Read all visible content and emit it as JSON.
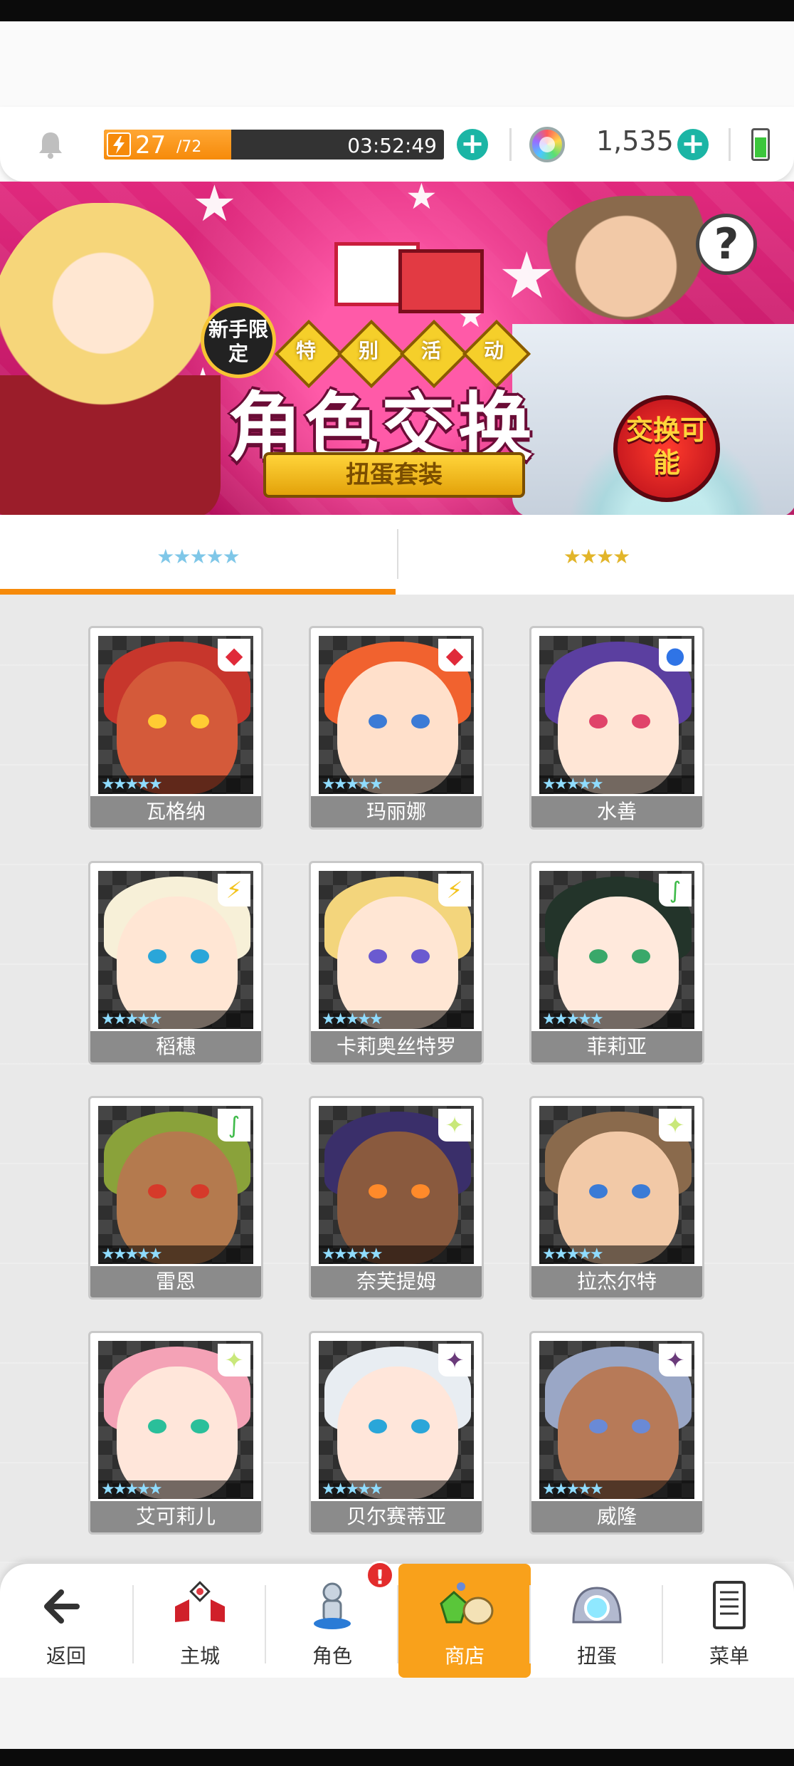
{
  "topbar": {
    "stamina_current": "27",
    "stamina_max": "/72",
    "stamina_fraction": 0.375,
    "stamina_timer": "03:52:49",
    "gem_count": "1,535",
    "accent_teal": "#1bb5a5",
    "accent_orange": "#f68a0a"
  },
  "banner": {
    "newbie_label": "新手限定",
    "event_tags": [
      "特",
      "别",
      "活",
      "动"
    ],
    "title": "角色交换",
    "ribbon": "扭蛋套装",
    "exchange_badge": "交换可能",
    "help_glyph": "?"
  },
  "tabs": [
    {
      "stars": "★★★★★",
      "active": true
    },
    {
      "stars": "★★★★",
      "active": false
    }
  ],
  "characters": [
    {
      "name": "瓦格纳",
      "element": "diamond-icon",
      "element_glyph": "◆",
      "element_color": "#e02a3a",
      "hair": "#c7362c",
      "skin": "#d45a3a",
      "eye": "#ffcc33"
    },
    {
      "name": "玛丽娜",
      "element": "diamond-icon",
      "element_glyph": "◆",
      "element_color": "#e02a3a",
      "hair": "#f1622f",
      "skin": "#ffe0cb",
      "eye": "#3b7bd6"
    },
    {
      "name": "水善",
      "element": "water-orb-icon",
      "element_glyph": "●",
      "element_color": "#2f74e6",
      "hair": "#5b3fa0",
      "skin": "#ffe6d6",
      "eye": "#e0446a"
    },
    {
      "name": "稻穗",
      "element": "lightning-icon",
      "element_glyph": "⚡",
      "element_color": "#f3c31c",
      "hair": "#f7f0d8",
      "skin": "#ffe6d4",
      "eye": "#2aa6d9"
    },
    {
      "name": "卡莉奥丝特罗",
      "element": "lightning-icon",
      "element_glyph": "⚡",
      "element_color": "#f3c31c",
      "hair": "#f3d57c",
      "skin": "#ffe6d4",
      "eye": "#6a5ad0"
    },
    {
      "name": "菲莉亚",
      "element": "wind-icon",
      "element_glyph": "∫",
      "element_color": "#3fbb4a",
      "hair": "#23342a",
      "skin": "#ffe9dc",
      "eye": "#3aa86a"
    },
    {
      "name": "雷恩",
      "element": "wind-icon",
      "element_glyph": "∫",
      "element_color": "#3fbb4a",
      "hair": "#8aa23a",
      "skin": "#b47a4e",
      "eye": "#d63a2a"
    },
    {
      "name": "奈芙提姆",
      "element": "light-icon",
      "element_glyph": "✦",
      "element_color": "#c9e87a",
      "hair": "#3a2f6a",
      "skin": "#8a5a3e",
      "eye": "#ff8a2a"
    },
    {
      "name": "拉杰尔特",
      "element": "light-icon",
      "element_glyph": "✦",
      "element_color": "#c9e87a",
      "hair": "#8a6a4c",
      "skin": "#f2c9a7",
      "eye": "#3b7bd6"
    },
    {
      "name": "艾可莉儿",
      "element": "light-icon",
      "element_glyph": "✦",
      "element_color": "#c9e87a",
      "hair": "#f4a2b6",
      "skin": "#ffe6da",
      "eye": "#2abf9a"
    },
    {
      "name": "贝尔赛蒂亚",
      "element": "shadow-icon",
      "element_glyph": "✦",
      "element_color": "#6a3a7a",
      "hair": "#e8edf2",
      "skin": "#ffe6da",
      "eye": "#2aa6d9"
    },
    {
      "name": "威隆",
      "element": "shadow-icon",
      "element_glyph": "✦",
      "element_color": "#6a3a7a",
      "hair": "#9aa7c6",
      "skin": "#b77a58",
      "eye": "#6a8ad6"
    }
  ],
  "rarity_stars": "★★★★★",
  "nav": [
    {
      "label": "返回",
      "icon": "back-arrow-icon"
    },
    {
      "label": "主城",
      "icon": "castle-icon"
    },
    {
      "label": "角色",
      "icon": "character-icon"
    },
    {
      "label": "商店",
      "icon": "shop-icon"
    },
    {
      "label": "扭蛋",
      "icon": "gacha-icon"
    },
    {
      "label": "菜单",
      "icon": "menu-book-icon"
    }
  ],
  "nav_alert_glyph": "!"
}
